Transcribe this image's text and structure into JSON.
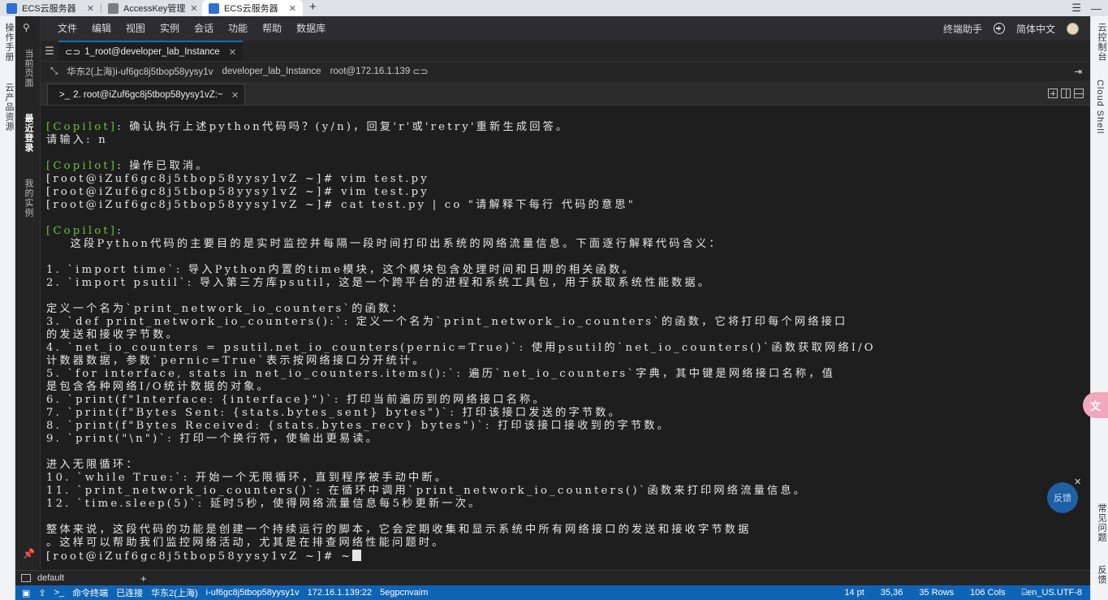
{
  "browser_tabs": [
    {
      "title": "ECS云服务器",
      "active": false,
      "favicon_color": "#2f6fd6"
    },
    {
      "title": "AccessKey管理",
      "active": false,
      "favicon_color": "#7d7d7d"
    },
    {
      "title": "ECS云服务器",
      "active": true,
      "favicon_color": "#2f6fd6"
    }
  ],
  "left_rail": {
    "items": [
      "操作手册",
      "云产品资源"
    ]
  },
  "right_rail": {
    "items": [
      "云控制台",
      "Cloud Shell",
      "常见问题",
      "反馈"
    ]
  },
  "sidebar": {
    "items": [
      "当前页面",
      "最近登录",
      "我的实例"
    ],
    "active": "最近登录"
  },
  "menubar": {
    "items": [
      "文件",
      "编辑",
      "视图",
      "实例",
      "会话",
      "功能",
      "帮助",
      "数据库"
    ],
    "assistant": "终端助手",
    "language": "简体中文"
  },
  "session_tab": {
    "label": "1_root@developer_lab_Instance"
  },
  "connection": {
    "region_instance": "华东2(上海)i-uf6gc8j5tbop58yysy1v",
    "instance_name": "developer_lab_Instance",
    "user_host": "root@172.16.1.139"
  },
  "terminal_tab": {
    "label": "2. root@iZuf6gc8j5tbop58yysy1vZ:~"
  },
  "terminal_lines": [
    {
      "kind": "copilot",
      "tag": "[Copilot]",
      "text": ": 确认执行上述python代码吗？(y/n)，回复'r'或'retry'重新生成回答。"
    },
    {
      "kind": "plain",
      "text": "请输入: n"
    },
    {
      "kind": "blank",
      "text": ""
    },
    {
      "kind": "copilot",
      "tag": "[Copilot]",
      "text": ": 操作已取消。"
    },
    {
      "kind": "plain",
      "text": "[root@iZuf6gc8j5tbop58yysy1vZ ~]# vim test.py"
    },
    {
      "kind": "plain",
      "text": "[root@iZuf6gc8j5tbop58yysy1vZ ~]# vim test.py"
    },
    {
      "kind": "plain",
      "text": "[root@iZuf6gc8j5tbop58yysy1vZ ~]# cat test.py | co \"请解释下每行 代码的意思\""
    },
    {
      "kind": "blank",
      "text": ""
    },
    {
      "kind": "copilot",
      "tag": "[Copilot]",
      "text": ":"
    },
    {
      "kind": "plain",
      "text": "    这段Python代码的主要目的是实时监控并每隔一段时间打印出系统的网络流量信息。下面逐行解释代码含义："
    },
    {
      "kind": "blank",
      "text": ""
    },
    {
      "kind": "plain",
      "text": "1. `import time`: 导入Python内置的time模块，这个模块包含处理时间和日期的相关函数。"
    },
    {
      "kind": "plain",
      "text": "2. `import psutil`: 导入第三方库psutil，这是一个跨平台的进程和系统工具包，用于获取系统性能数据。"
    },
    {
      "kind": "blank",
      "text": ""
    },
    {
      "kind": "plain",
      "text": "定义一个名为`print_network_io_counters`的函数："
    },
    {
      "kind": "plain",
      "text": "3. `def print_network_io_counters():`: 定义一个名为`print_network_io_counters`的函数，它将打印每个网络接口"
    },
    {
      "kind": "plain",
      "text": "的发送和接收字节数。"
    },
    {
      "kind": "plain",
      "text": "4. `net_io_counters = psutil.net_io_counters(pernic=True)`: 使用psutil的`net_io_counters()`函数获取网络I/O"
    },
    {
      "kind": "plain",
      "text": "计数器数据，参数`pernic=True`表示按网络接口分开统计。"
    },
    {
      "kind": "plain",
      "text": "5. `for interface, stats in net_io_counters.items():`: 遍历`net_io_counters`字典，其中键是网络接口名称，值"
    },
    {
      "kind": "plain",
      "text": "是包含各种网络I/O统计数据的对象。"
    },
    {
      "kind": "plain",
      "text": "6. `print(f\"Interface: {interface}\")`: 打印当前遍历到的网络接口名称。"
    },
    {
      "kind": "plain",
      "text": "7. `print(f\"Bytes Sent: {stats.bytes_sent} bytes\")`: 打印该接口发送的字节数。"
    },
    {
      "kind": "plain",
      "text": "8. `print(f\"Bytes Received: {stats.bytes_recv} bytes\")`: 打印该接口接收到的字节数。"
    },
    {
      "kind": "plain",
      "text": "9. `print(\"\\n\")`: 打印一个换行符，使输出更易读。"
    },
    {
      "kind": "blank",
      "text": ""
    },
    {
      "kind": "plain",
      "text": "进入无限循环："
    },
    {
      "kind": "plain",
      "text": "10. `while True:`: 开始一个无限循环，直到程序被手动中断。"
    },
    {
      "kind": "plain",
      "text": "11. `print_network_io_counters()`: 在循环中调用`print_network_io_counters()`函数来打印网络流量信息。"
    },
    {
      "kind": "plain",
      "text": "12. `time.sleep(5)`: 延时5秒，使得网络流量信息每5秒更新一次。"
    },
    {
      "kind": "blank",
      "text": ""
    },
    {
      "kind": "plain",
      "text": "整体来说，这段代码的功能是创建一个持续运行的脚本，它会定期收集和显示系统中所有网络接口的发送和接收字节数据"
    },
    {
      "kind": "plain",
      "text": "。这样可以帮助我们监控网络活动，尤其是在排查网络性能问题时。"
    },
    {
      "kind": "prompt",
      "text": "[root@iZuf6gc8j5tbop58yysy1vZ ~]# ~"
    }
  ],
  "overlays": {
    "translate_label": "文",
    "feedback_label": "反馈"
  },
  "panel": {
    "tab_label": "default"
  },
  "statusbar": {
    "command_terminal": "命令终端",
    "state": "已连接",
    "region": "华东2(上海)",
    "instance_id": "i-uf6gc8j5tbop58yysy1v",
    "ip": "172.16.1.139:22",
    "session": "5egpcnvaim",
    "font_size": "14 pt",
    "cursor_pos": "35,36",
    "rows": "35 Rows",
    "cols": "106 Cols",
    "encoding": "en_US.UTF-8"
  },
  "colors": {
    "statusbar": "#0e63b5",
    "copilot_tag": "#6fbf3a",
    "terminal_bg": "#1e1e1e"
  }
}
